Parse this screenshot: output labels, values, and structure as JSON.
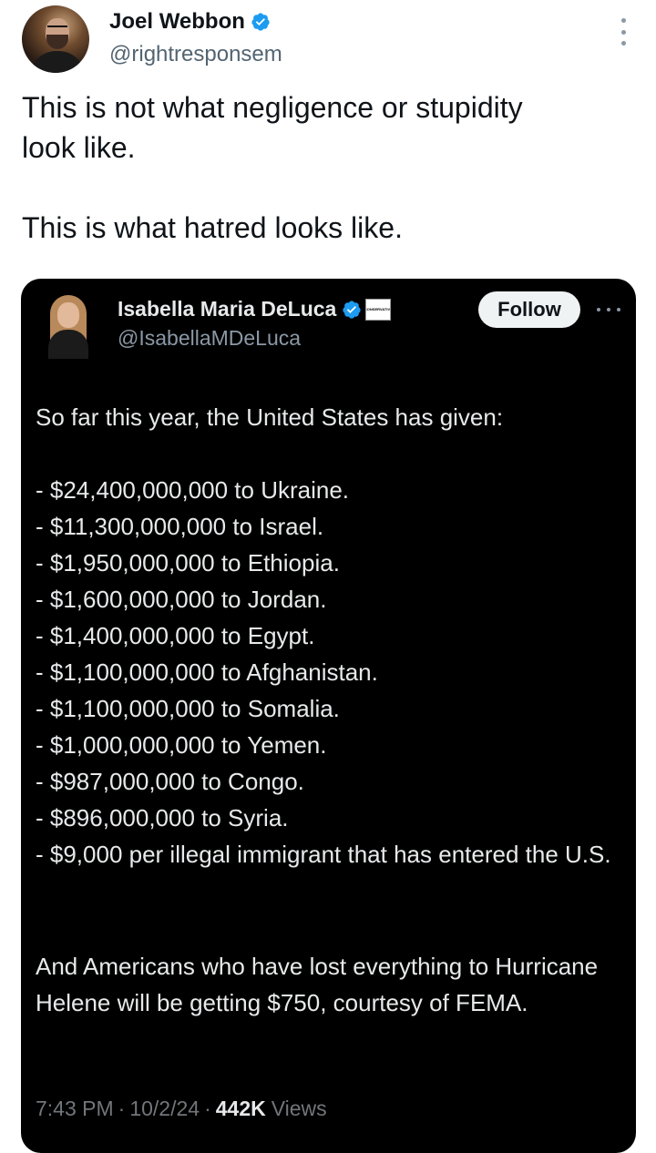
{
  "author": {
    "display_name": "Joel Webbon",
    "handle": "@rightresponsem",
    "verified_color": "#1d9bf0"
  },
  "tweet": {
    "text": "This is not what negligence or stupidity\nlook like.\n\nThis is what hatred looks like."
  },
  "embedded": {
    "display_name": "Isabella Maria DeLuca",
    "handle": "@IsabellaMDeLuca",
    "badge_text": "CONSERVATIVE",
    "follow_label": "Follow",
    "intro": "So far this year, the United States has given:",
    "items": [
      "- $24,400,000,000 to Ukraine.",
      "- $11,300,000,000 to Israel.",
      "- $1,950,000,000 to Ethiopia.",
      "- $1,600,000,000 to Jordan.",
      "- $1,400,000,000 to Egypt.",
      "- $1,100,000,000 to Afghanistan.",
      "- $1,100,000,000 to Somalia.",
      "- $1,000,000,000 to Yemen.",
      "- $987,000,000 to Congo.",
      "- $896,000,000 to Syria.",
      "- $9,000 per illegal immigrant that has entered the U.S."
    ],
    "closing": "And Americans who have lost everything to Hurricane Helene will be getting $750, courtesy of FEMA.",
    "time": "7:43 PM",
    "date": "10/2/24",
    "views_count": "442K",
    "views_label": "Views",
    "separator": "·"
  }
}
